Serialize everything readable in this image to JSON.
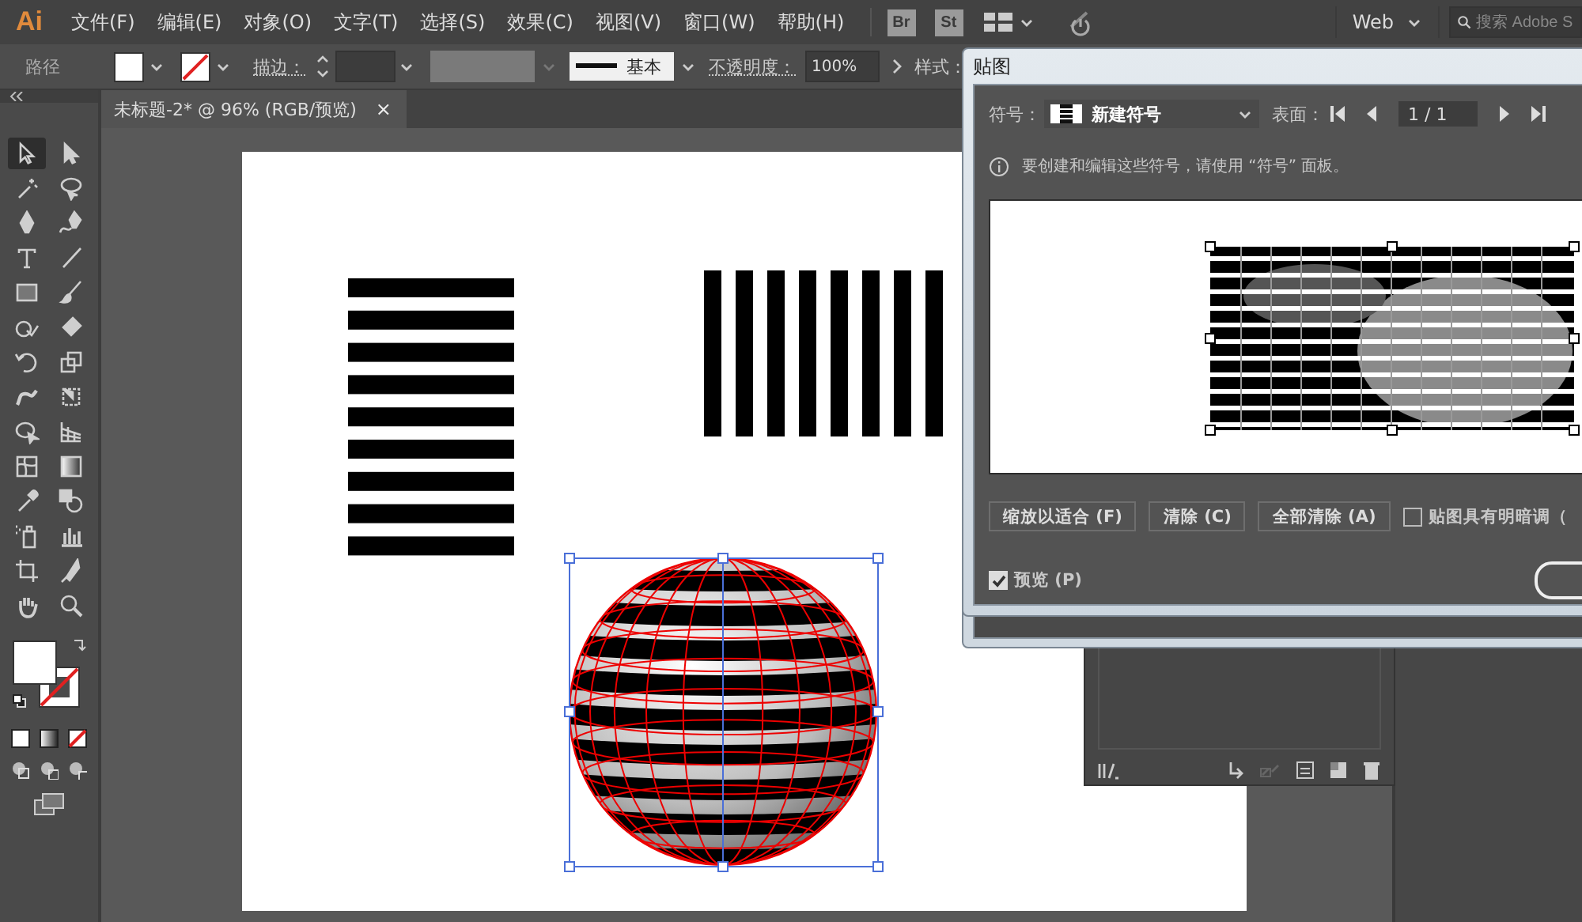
{
  "menubar": {
    "logo": "Ai",
    "menus": [
      "文件(F)",
      "编辑(E)",
      "对象(O)",
      "文字(T)",
      "选择(S)",
      "效果(C)",
      "视图(V)",
      "窗口(W)",
      "帮助(H)"
    ],
    "apps": [
      "Br",
      "St"
    ],
    "workspace": "Web",
    "search": {
      "placeholder": "搜索 Adobe S"
    }
  },
  "control_bar": {
    "selection": "路径",
    "stroke_label": "描边：",
    "stroke_profile": "基本",
    "opacity_label": "不透明度：",
    "opacity": "100%",
    "style_label": "样式："
  },
  "tools": [
    {
      "kind": "selection",
      "selected": true
    },
    {
      "kind": "direct-selection",
      "selected": false
    },
    {
      "kind": "magic-wand",
      "selected": false
    },
    {
      "kind": "lasso",
      "selected": false
    },
    {
      "kind": "pen",
      "selected": false
    },
    {
      "kind": "curvature",
      "selected": false
    },
    {
      "kind": "type",
      "selected": false
    },
    {
      "kind": "line",
      "selected": false
    },
    {
      "kind": "rectangle",
      "selected": false
    },
    {
      "kind": "paintbrush",
      "selected": false
    },
    {
      "kind": "shaper",
      "selected": false
    },
    {
      "kind": "eraser",
      "selected": false
    },
    {
      "kind": "rotate",
      "selected": false
    },
    {
      "kind": "scale",
      "selected": false
    },
    {
      "kind": "warp",
      "selected": false
    },
    {
      "kind": "free-transform",
      "selected": false
    },
    {
      "kind": "shape-builder",
      "selected": false
    },
    {
      "kind": "perspective",
      "selected": false
    },
    {
      "kind": "mesh",
      "selected": false
    },
    {
      "kind": "gradient",
      "selected": false
    },
    {
      "kind": "eyedropper",
      "selected": false
    },
    {
      "kind": "blend",
      "selected": false
    },
    {
      "kind": "symbol-sprayer",
      "selected": false
    },
    {
      "kind": "graph",
      "selected": false
    },
    {
      "kind": "artboard",
      "selected": false
    },
    {
      "kind": "slice",
      "selected": false
    },
    {
      "kind": "hand",
      "selected": false
    },
    {
      "kind": "zoom",
      "selected": false
    }
  ],
  "document_tab": {
    "title": "未标题-2* @ 96% (RGB/预览)",
    "close": "×"
  },
  "dialog": {
    "title": "贴图",
    "symbol_label": "符号：",
    "symbol": "新建符号",
    "surface_label": "表面：",
    "page": "1 / 1",
    "info": "要创建和编辑这些符号，请使用 “符号” 面板。",
    "buttons": [
      "缩放以适合 (F)",
      "清除 (C)",
      "全部清除 (A)"
    ],
    "shade": {
      "label": "贴图具有明暗调（",
      "checked": false
    },
    "preview": {
      "label": "预览 (P)",
      "checked": true
    }
  }
}
